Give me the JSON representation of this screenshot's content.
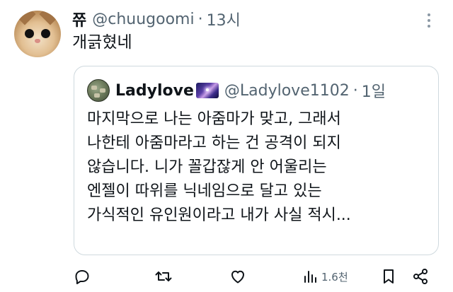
{
  "tweet": {
    "author_name": "쮸",
    "handle": "@chuugoomi",
    "separator": "·",
    "time": "13시",
    "text": "개긁혔네"
  },
  "quote": {
    "author_name": "Ladylove",
    "emoji_icon": "galaxy-icon",
    "handle": "@Ladylove1102",
    "separator": "·",
    "time": "1일",
    "lines": [
      "마지막으로 나는 아줌마가 맞고, 그래서",
      "나한테 아줌마라고 하는 건 공격이 되지",
      "않습니다. 니가 꼴갑잖게 안 어울리는",
      "엔젤이 따위를 닉네임으로 달고 있는",
      "가식적인 유인원이라고 내가 사실 적시..."
    ]
  },
  "actions": {
    "reply_icon": "reply-icon",
    "retweet_icon": "retweet-icon",
    "like_icon": "like-icon",
    "views_icon": "views-icon",
    "views_count": "1.6천",
    "bookmark_icon": "bookmark-icon",
    "share_icon": "share-icon"
  },
  "colors": {
    "text": "#0f1419",
    "secondary": "#536471",
    "border": "#cfd9de"
  }
}
